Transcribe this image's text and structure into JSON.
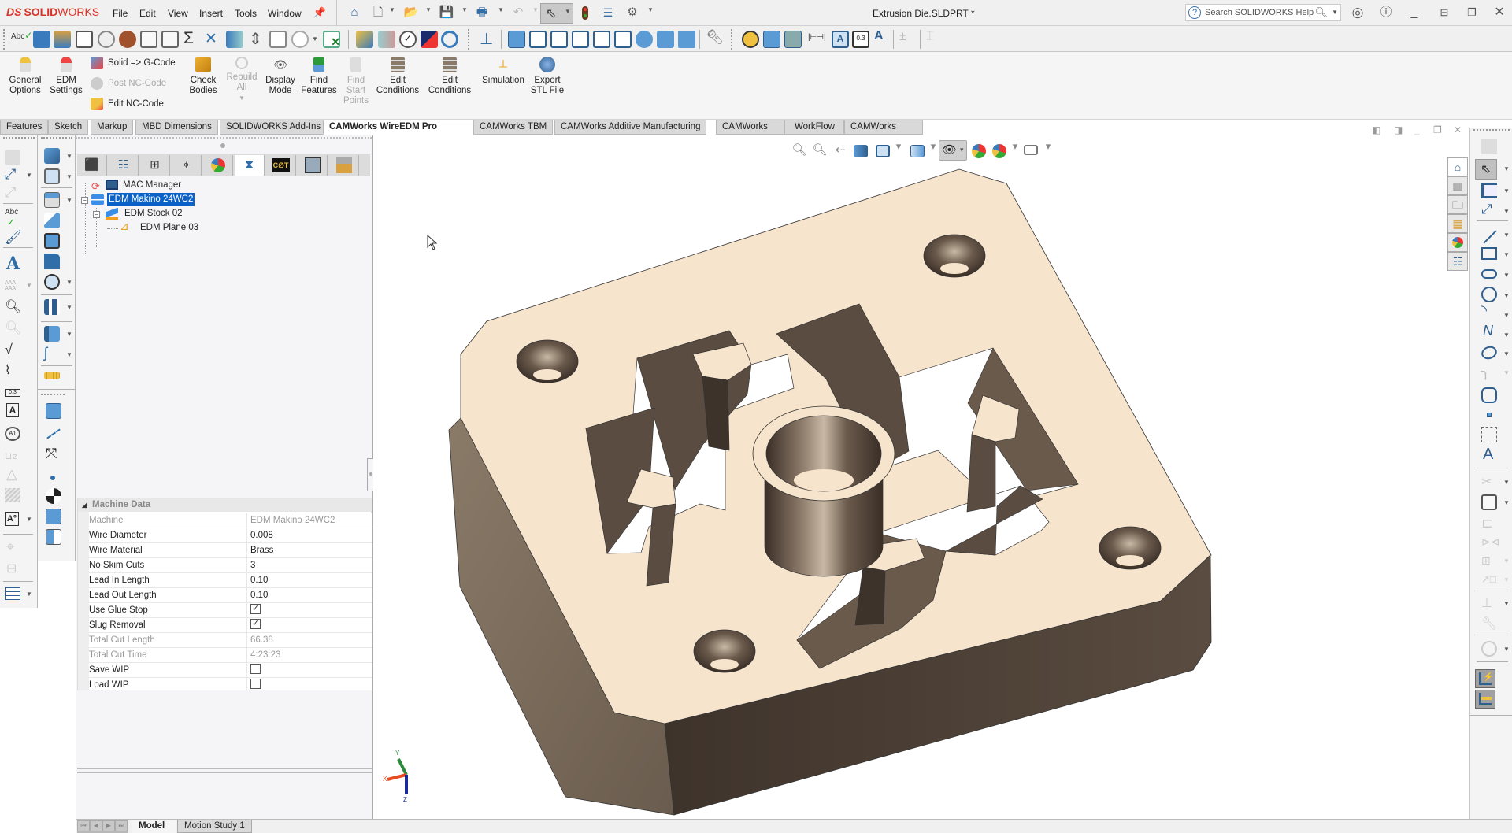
{
  "app": {
    "name": "SOLIDWORKS",
    "document_title": "Extrusion Die.SLDPRT *"
  },
  "menu": [
    "File",
    "Edit",
    "View",
    "Insert",
    "Tools",
    "Window"
  ],
  "search": {
    "placeholder": "Search SOLIDWORKS Help"
  },
  "command_manager": {
    "buttons": [
      {
        "label_1": "General",
        "label_2": "Options",
        "icon": "general-options-icon",
        "enabled": true
      },
      {
        "label_1": "EDM",
        "label_2": "Settings",
        "icon": "edm-settings-icon",
        "enabled": true
      },
      {
        "label_1": "Check",
        "label_2": "Bodies",
        "icon": "check-bodies-icon",
        "enabled": true
      },
      {
        "label_1": "Rebuild",
        "label_2": "All",
        "icon": "rebuild-all-icon",
        "enabled": false
      },
      {
        "label_1": "Display",
        "label_2": "Mode",
        "icon": "display-mode-icon",
        "enabled": true
      },
      {
        "label_1": "Find",
        "label_2": "Features",
        "icon": "find-features-icon",
        "enabled": true
      },
      {
        "label_1": "Find",
        "label_2": "Start",
        "label_3": "Points",
        "icon": "find-start-points-icon",
        "enabled": false
      },
      {
        "label_1": "Edit",
        "label_2": "Conditions",
        "icon": "edit-conditions-icon",
        "enabled": true
      },
      {
        "label_1": "Edit",
        "label_2": "Conditions",
        "icon": "edit-conditions-icon",
        "enabled": true
      },
      {
        "label_1": "Simulation",
        "icon": "simulation-icon",
        "enabled": true
      },
      {
        "label_1": "Export",
        "label_2": "STL File",
        "icon": "export-stl-icon",
        "enabled": true
      }
    ],
    "stacked": [
      {
        "label": "Solid => G-Code",
        "enabled": true
      },
      {
        "label": "Post NC-Code",
        "enabled": false
      },
      {
        "label": "Edit NC-Code",
        "enabled": true
      }
    ]
  },
  "tabs": [
    {
      "label": "Features",
      "active": false
    },
    {
      "label": "Sketch",
      "active": false
    },
    {
      "label": "Markup",
      "active": false
    },
    {
      "label": "MBD Dimensions",
      "active": false
    },
    {
      "label": "SOLIDWORKS Add-Ins",
      "active": false
    },
    {
      "label": "CAMWorks WireEDM Pro",
      "active": true
    },
    {
      "label": "CAMWorks TBM",
      "active": false
    },
    {
      "label": "CAMWorks Additive Manufacturing",
      "active": false
    },
    {
      "label": "CAMWorks",
      "active": false
    },
    {
      "label": "WorkFlow",
      "active": false
    },
    {
      "label": "CAMWorks",
      "active": false
    }
  ],
  "feature_tree": {
    "items": [
      {
        "label": "MAC Manager",
        "level": 0,
        "selected": false
      },
      {
        "label": "EDM Makino 24WC2",
        "level": 0,
        "selected": true
      },
      {
        "label": "EDM Stock 02",
        "level": 1,
        "selected": false
      },
      {
        "label": "EDM Plane 03",
        "level": 2,
        "selected": false
      }
    ]
  },
  "properties": {
    "group": "Machine Data",
    "rows": [
      {
        "key": "Machine",
        "value": "EDM Makino 24WC2",
        "readonly": true
      },
      {
        "key": "Wire Diameter",
        "value": "0.008",
        "readonly": false
      },
      {
        "key": "Wire Material",
        "value": "Brass",
        "readonly": false
      },
      {
        "key": "No Skim Cuts",
        "value": "3",
        "readonly": false
      },
      {
        "key": "Lead In Length",
        "value": "0.10",
        "readonly": false
      },
      {
        "key": "Lead Out Length",
        "value": "0.10",
        "readonly": false
      },
      {
        "key": "Use Glue Stop",
        "checkbox": true,
        "checked": true
      },
      {
        "key": "Slug Removal",
        "checkbox": true,
        "checked": true
      },
      {
        "key": "Total Cut Length",
        "value": "66.38",
        "readonly": true
      },
      {
        "key": "Total Cut Time",
        "value": "4:23:23",
        "readonly": true
      },
      {
        "key": "Save WIP",
        "checkbox": true,
        "checked": false
      },
      {
        "key": "Load WIP",
        "checkbox": true,
        "checked": false
      }
    ]
  },
  "bottom_tabs": [
    {
      "label": "Model",
      "active": true
    },
    {
      "label": "Motion Study 1",
      "active": false
    }
  ],
  "triad": {
    "x": "X",
    "y": "Y",
    "z": "Z"
  },
  "colors": {
    "brand_red": "#d8352a",
    "selection_blue": "#0a62c8",
    "part_face": "#f7e4cc",
    "part_side_dark": "#4a3e35",
    "part_side_light": "#8a7a68"
  }
}
